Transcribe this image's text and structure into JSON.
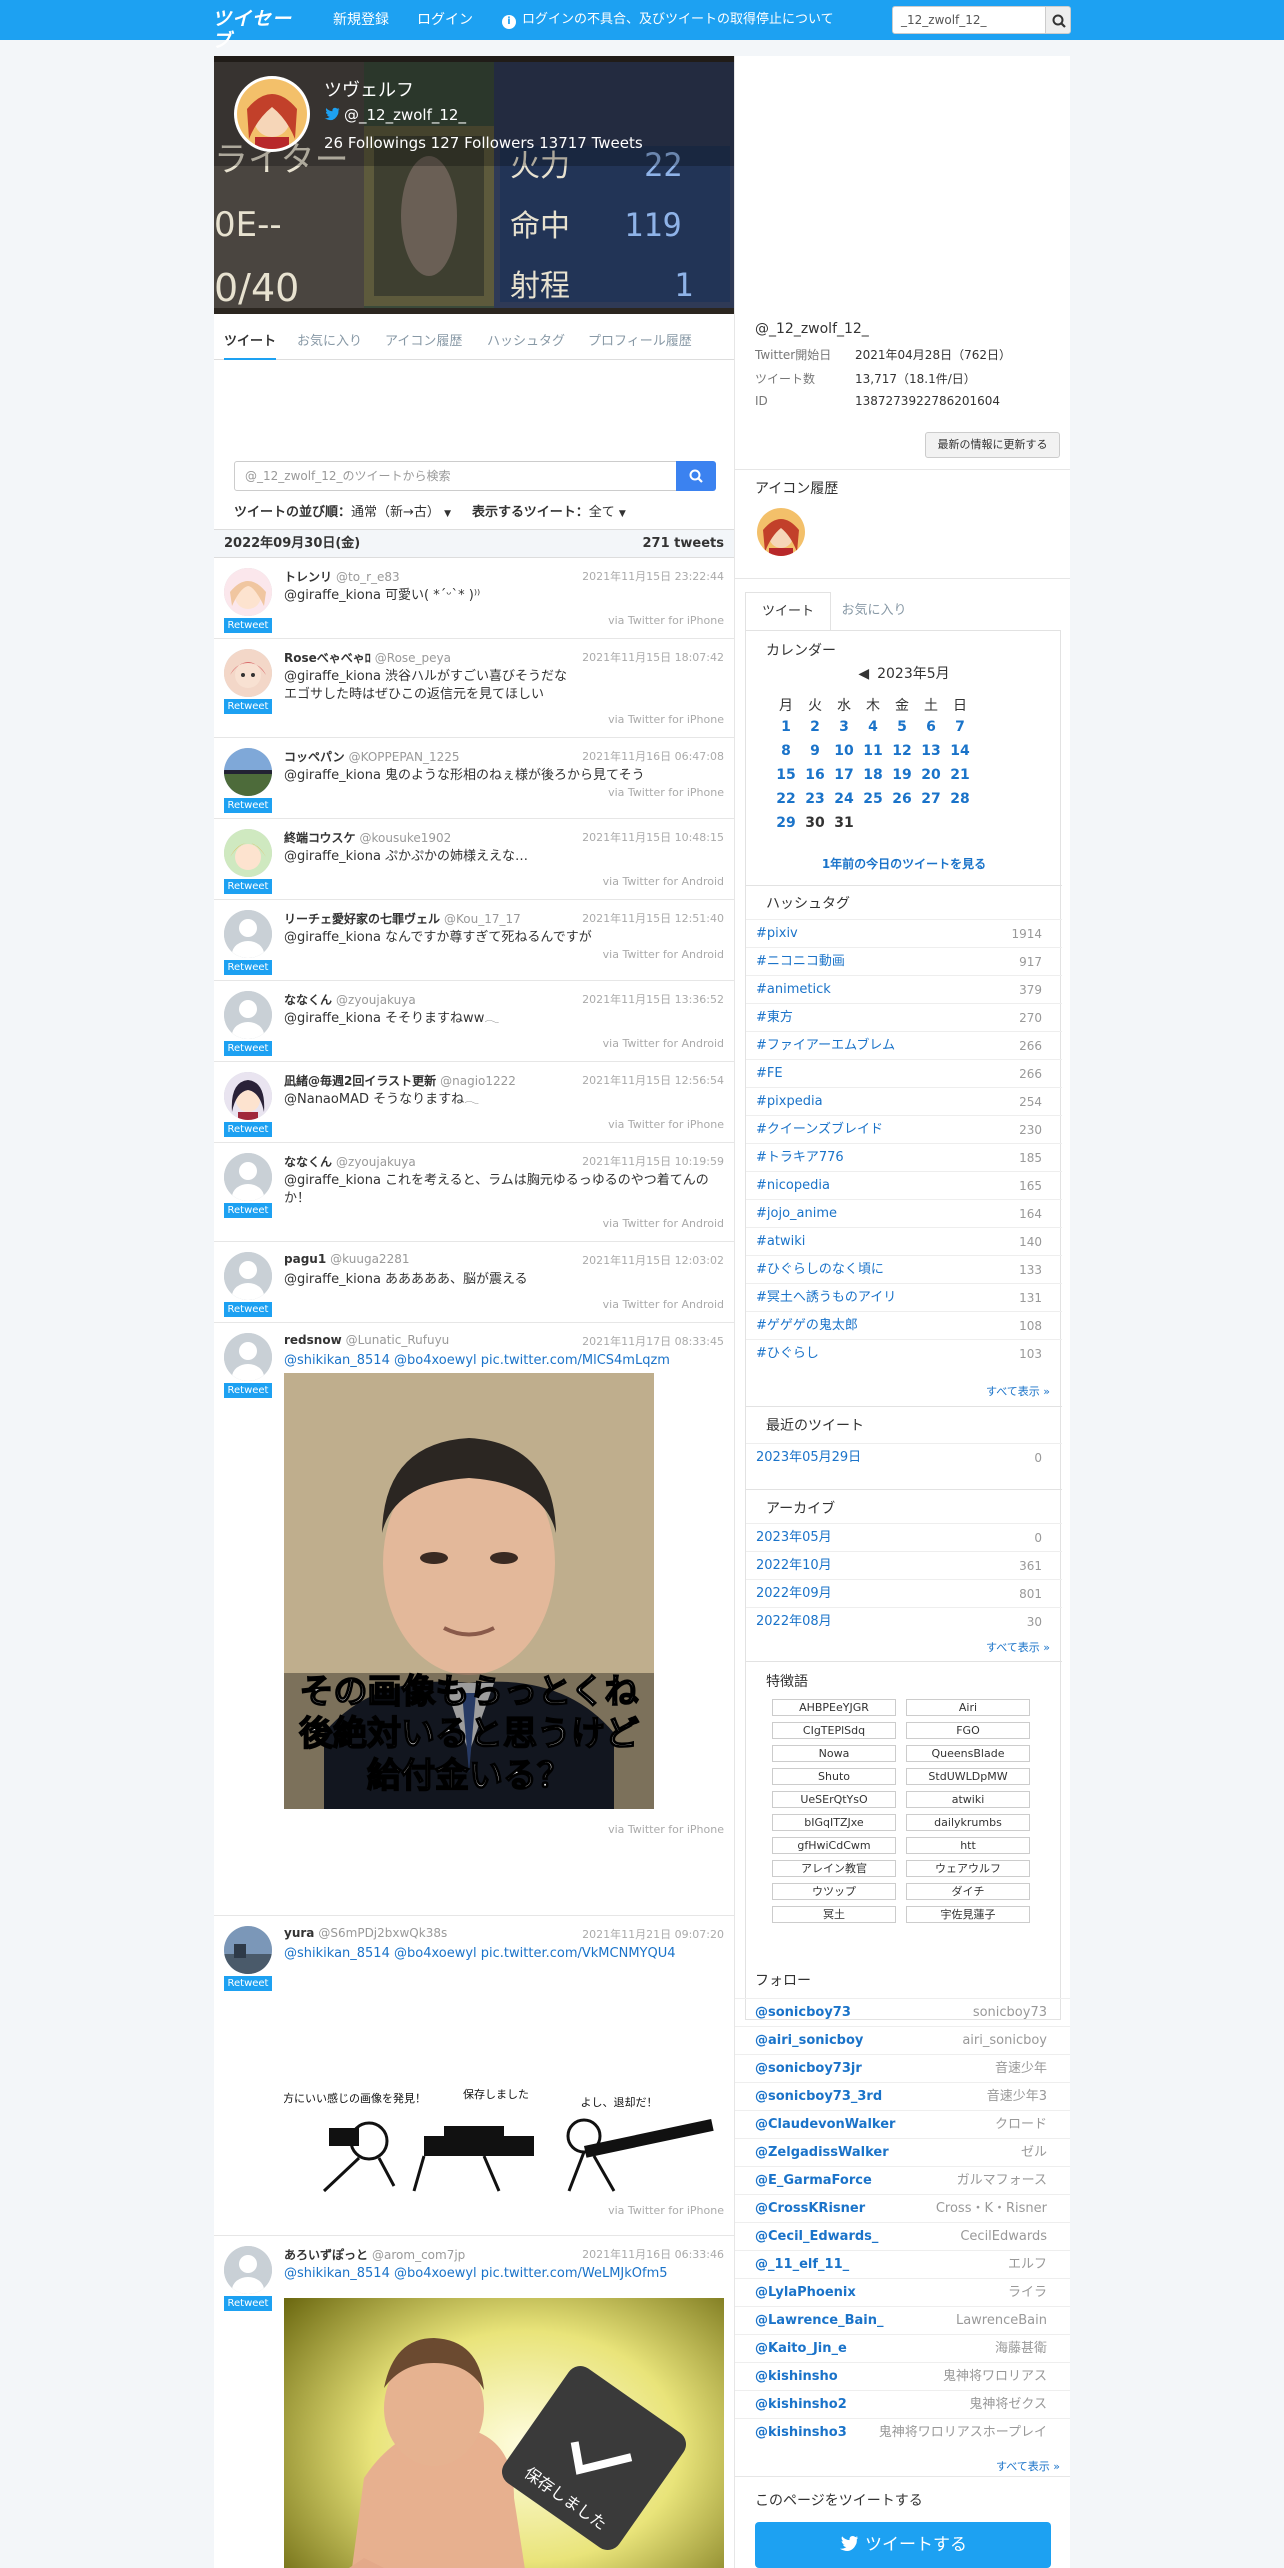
{
  "header": {
    "logo": "ツイセーブ",
    "nav_register": "新規登録",
    "nav_login": "ログイン",
    "nav_notice": "ログインの不具合、及びツイートの取得停止について",
    "search_value": "_12_zwolf_12_"
  },
  "profile": {
    "name": "ツヴェルフ",
    "handle": "@_12_zwolf_12_",
    "stats": "26 Followings 127 Followers  13717 Tweets",
    "banner_text": [
      "ライター",
      "0E--",
      "0/40",
      "火力",
      "22",
      "命中",
      "119",
      "射程",
      "1"
    ]
  },
  "tabs": [
    "ツイート",
    "お気に入り",
    "アイコン履歴",
    "ハッシュタグ",
    "プロフィール履歴"
  ],
  "search": {
    "placeholder": "@_12_zwolf_12_のツイートから検索"
  },
  "sort": {
    "order_label": "ツイートの並び順：",
    "order_value": "通常（新→古）",
    "show_label": "表示するツイート：",
    "show_value": "全て"
  },
  "day": {
    "date": "2022年09月30日(金)",
    "count": "271 tweets"
  },
  "retweet_badge": "Retweet",
  "tweets": [
    {
      "name": "トレンリ",
      "handle": "@to_r_e83",
      "time": "2021年11月15日 23:22:44",
      "text": "@giraffe_kiona 可愛い( *ˊᵕˋ* )⁾⁾",
      "via": "via Twitter for iPhone"
    },
    {
      "name": "Roseべゃべゃﾛ",
      "handle": "@Rose_peya",
      "time": "2021年11月15日 18:07:42",
      "text": "@giraffe_kiona 渋谷ハルがすごい喜びそうだな\nエゴサした時はぜひこの返信元を見てほしい",
      "via": "via Twitter for iPhone"
    },
    {
      "name": "コッペパン",
      "handle": "@KOPPEPAN_1225",
      "time": "2021年11月16日 06:47:08",
      "text": "@giraffe_kiona 鬼のような形相のねぇ様が後ろから見てそう",
      "via": "via Twitter for iPhone"
    },
    {
      "name": "終端コウスケ",
      "handle": "@kousuke1902",
      "time": "2021年11月15日 10:48:15",
      "text": "@giraffe_kiona ぷかぷかの姉様ええな…",
      "via": "via Twitter for Android"
    },
    {
      "name": "リーチェ愛好家の七罪ヴェル",
      "handle": "@Kou_17_17",
      "time": "2021年11月15日 12:51:40",
      "text": "@giraffe_kiona なんですか尊すぎて死ねるんですが",
      "via": "via Twitter for Android"
    },
    {
      "name": "ななくん",
      "handle": "@zyoujakuya",
      "time": "2021年11月15日 13:36:52",
      "text": "@giraffe_kiona そそりますねww𓂃",
      "via": "via Twitter for Android"
    },
    {
      "name": "凪緒@毎週2回イラスト更新",
      "handle": "@nagio1222",
      "time": "2021年11月15日 12:56:54",
      "text": "@NanaoMAD そうなりますね𓂃",
      "via": "via Twitter for iPhone"
    },
    {
      "name": "ななくん",
      "handle": "@zyoujakuya",
      "time": "2021年11月15日 10:19:59",
      "text": "@giraffe_kiona これを考えると、ラムは胸元ゆるっゆるのやつ着てんのか！",
      "via": "via Twitter for Android"
    },
    {
      "name": "pagu1",
      "handle": "@kuuga2281",
      "time": "2021年11月15日 12:03:02",
      "text": "@giraffe_kiona あああああ、脳が震える",
      "via": "via Twitter for Android"
    },
    {
      "name": "redsnow",
      "handle": "@Lunatic_Rufuyu",
      "time": "2021年11月17日 08:33:45",
      "text": "@shikikan_8514 @bo4xoewyl pic.twitter.com/MlCS4mLqzm",
      "via": "via Twitter for iPhone",
      "image_caption": [
        "その画像もらっとくね",
        "後絶対いると思うけど",
        "給付金いる？"
      ]
    },
    {
      "name": "yura",
      "handle": "@S6mPDj2bxwQk38s",
      "time": "2021年11月21日 09:07:20",
      "text": "@shikikan_8514 @bo4xoewyl pic.twitter.com/VkMCNMYQU4",
      "via": "via Twitter for iPhone",
      "image_caption": [
        "前方にいい感じの画像を発見！",
        "保存しました",
        "よし、退却だ！"
      ]
    },
    {
      "name": "あろいずぽっと",
      "handle": "@arom_com7jp",
      "time": "2021年11月16日 06:33:46",
      "text": "@shikikan_8514 @bo4xoewyl pic.twitter.com/WeLMJkOfm5",
      "via": "",
      "image_caption": [
        "保存しました"
      ]
    }
  ],
  "account": {
    "handle": "@_12_zwolf_12_",
    "rows": [
      {
        "label": "Twitter開始日",
        "value": "2021年04月28日（762日）"
      },
      {
        "label": "ツイート数",
        "value": "13,717（18.1件/日）"
      },
      {
        "label": "ID",
        "value": "1387273922786201604"
      }
    ],
    "update_button": "最新の情報に更新する"
  },
  "icon_history": {
    "title": "アイコン履歴"
  },
  "side_tabs": [
    "ツイート",
    "お気に入り"
  ],
  "calendar": {
    "title": "カレンダー",
    "month": "2023年5月",
    "day_names": [
      "月",
      "火",
      "水",
      "木",
      "金",
      "土",
      "日"
    ],
    "weeks": [
      [
        "1",
        "2",
        "3",
        "4",
        "5",
        "6",
        "7"
      ],
      [
        "8",
        "9",
        "10",
        "11",
        "12",
        "13",
        "14"
      ],
      [
        "15",
        "16",
        "17",
        "18",
        "19",
        "20",
        "21"
      ],
      [
        "22",
        "23",
        "24",
        "25",
        "26",
        "27",
        "28"
      ],
      [
        "29",
        "30",
        "31",
        "",
        "",
        "",
        ""
      ]
    ],
    "link": "1年前の今日のツイートを見る"
  },
  "hashtags": {
    "title": "ハッシュタグ",
    "items": [
      {
        "tag": "#pixiv",
        "count": "1914"
      },
      {
        "tag": "#ニコニコ動画",
        "count": "917"
      },
      {
        "tag": "#animetick",
        "count": "379"
      },
      {
        "tag": "#東方",
        "count": "270"
      },
      {
        "tag": "#ファイアーエムブレム",
        "count": "266"
      },
      {
        "tag": "#FE",
        "count": "266"
      },
      {
        "tag": "#pixpedia",
        "count": "254"
      },
      {
        "tag": "#クイーンズブレイド",
        "count": "230"
      },
      {
        "tag": "#トラキア776",
        "count": "185"
      },
      {
        "tag": "#nicopedia",
        "count": "165"
      },
      {
        "tag": "#jojo_anime",
        "count": "164"
      },
      {
        "tag": "#atwiki",
        "count": "140"
      },
      {
        "tag": "#ひぐらしのなく頃に",
        "count": "133"
      },
      {
        "tag": "#冥土へ誘うものアイリ",
        "count": "131"
      },
      {
        "tag": "#ゲゲゲの鬼太郎",
        "count": "108"
      },
      {
        "tag": "#ひぐらし",
        "count": "103"
      }
    ],
    "more": "すべて表示 »"
  },
  "recent": {
    "title": "最近のツイート",
    "items": [
      {
        "date": "2023年05月29日",
        "count": "0"
      }
    ]
  },
  "archive": {
    "title": "アーカイブ",
    "items": [
      {
        "date": "2023年05月",
        "count": "0"
      },
      {
        "date": "2022年10月",
        "count": "361"
      },
      {
        "date": "2022年09月",
        "count": "801"
      },
      {
        "date": "2022年08月",
        "count": "30"
      }
    ],
    "more": "すべて表示 »"
  },
  "keywords": {
    "title": "特徴語",
    "items": [
      "AHBPEeYJGR",
      "Airi",
      "CIgTEPlSdq",
      "FGO",
      "Nowa",
      "QueensBlade",
      "Shuto",
      "StdUWLDpMW",
      "UeSErQtYsO",
      "atwiki",
      "bIGqITZJxe",
      "dailykrumbs",
      "gfHwiCdCwm",
      "htt",
      "アレイン教官",
      "ウェアウルフ",
      "ウツップ",
      "ダイチ",
      "冥土",
      "宇佐見蓮子"
    ]
  },
  "follow": {
    "title": "フォロー",
    "items": [
      {
        "handle": "@sonicboy73",
        "name": "sonicboy73"
      },
      {
        "handle": "@airi_sonicboy",
        "name": "airi_sonicboy"
      },
      {
        "handle": "@sonicboy73jr",
        "name": "音速少年"
      },
      {
        "handle": "@sonicboy73_3rd",
        "name": "音速少年3"
      },
      {
        "handle": "@ClaudevonWalker",
        "name": "クロード"
      },
      {
        "handle": "@ZelgadissWalker",
        "name": "ゼル"
      },
      {
        "handle": "@E_GarmaForce",
        "name": "ガルマフォース"
      },
      {
        "handle": "@CrossKRisner",
        "name": "Cross・K・Risner"
      },
      {
        "handle": "@Cecil_Edwards_",
        "name": "CecilEdwards"
      },
      {
        "handle": "@_11_elf_11_",
        "name": "エルフ"
      },
      {
        "handle": "@LylaPhoenix",
        "name": "ライラ"
      },
      {
        "handle": "@Lawrence_Bain_",
        "name": "LawrenceBain"
      },
      {
        "handle": "@Kaito_Jin_e",
        "name": "海藤甚衛"
      },
      {
        "handle": "@kishinsho",
        "name": "鬼神将ワロリアス"
      },
      {
        "handle": "@kishinsho2",
        "name": "鬼神将ゼクス"
      },
      {
        "handle": "@kishinsho3",
        "name": "鬼神将ワロリアスホープレイ"
      }
    ],
    "more": "すべて表示 »"
  },
  "share": {
    "title": "このページをツイートする",
    "button": "ツイートする"
  },
  "colors": {
    "accent": "#1da1f2",
    "link": "#1a73c9",
    "background": "#f3f6f9"
  }
}
